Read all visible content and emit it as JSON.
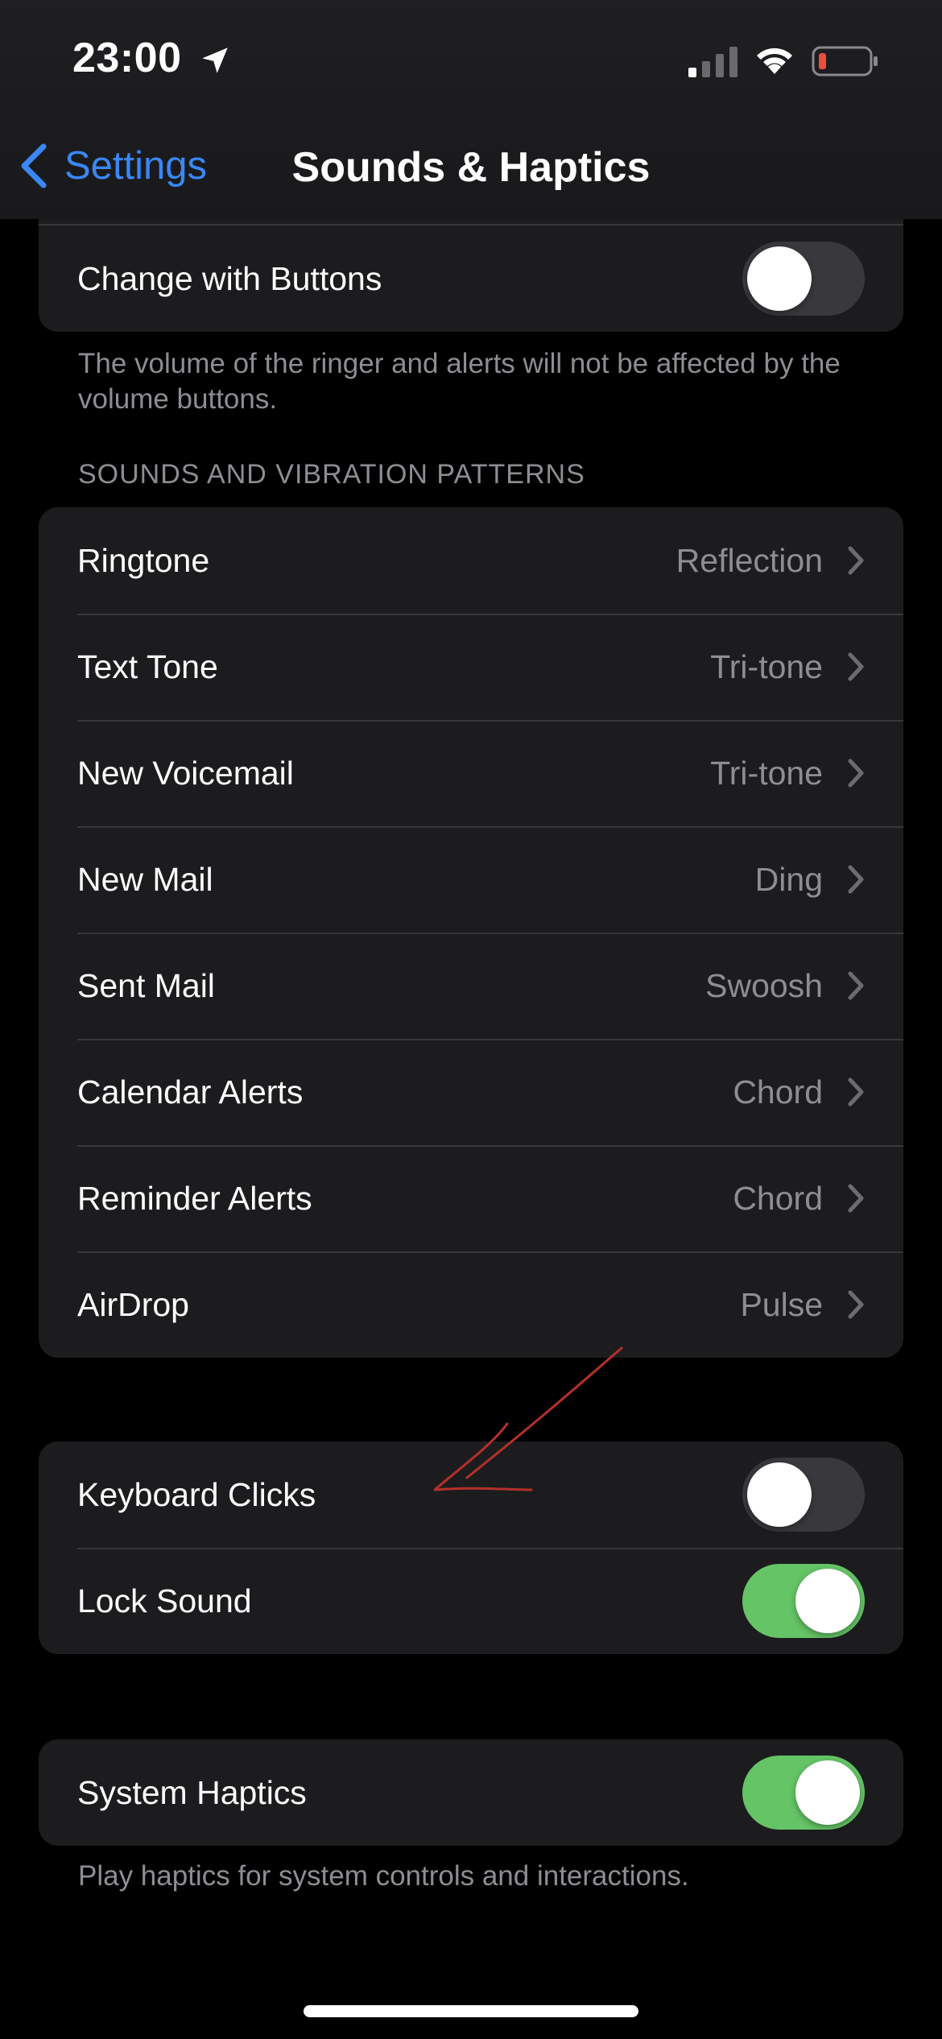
{
  "status_bar": {
    "time": "23:00",
    "icons": [
      "location-arrow-icon",
      "cellular-signal-icon",
      "wifi-icon",
      "battery-low-icon"
    ],
    "battery_color": "#eb4e3d"
  },
  "nav": {
    "back_label": "Settings",
    "title": "Sounds & Haptics",
    "accent_color": "#3a87f5"
  },
  "ringer_group": {
    "change_with_buttons": {
      "label": "Change with Buttons",
      "on": false
    },
    "footnote": "The volume of the ringer and alerts will not be affected by the volume buttons."
  },
  "patterns": {
    "header": "SOUNDS AND VIBRATION PATTERNS",
    "rows": [
      {
        "label": "Ringtone",
        "value": "Reflection"
      },
      {
        "label": "Text Tone",
        "value": "Tri-tone"
      },
      {
        "label": "New Voicemail",
        "value": "Tri-tone"
      },
      {
        "label": "New Mail",
        "value": "Ding"
      },
      {
        "label": "Sent Mail",
        "value": "Swoosh"
      },
      {
        "label": "Calendar Alerts",
        "value": "Chord"
      },
      {
        "label": "Reminder Alerts",
        "value": "Chord"
      },
      {
        "label": "AirDrop",
        "value": "Pulse"
      }
    ]
  },
  "clicks_group": {
    "keyboard_clicks": {
      "label": "Keyboard Clicks",
      "on": false
    },
    "lock_sound": {
      "label": "Lock Sound",
      "on": true
    }
  },
  "haptics_group": {
    "system_haptics": {
      "label": "System Haptics",
      "on": true
    },
    "footnote": "Play haptics for system controls and interactions."
  },
  "toggle_on_color": "#65c466",
  "annotation_color": "#b3302b"
}
